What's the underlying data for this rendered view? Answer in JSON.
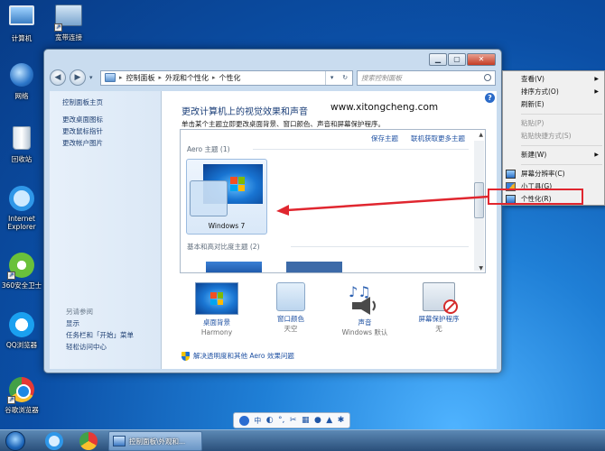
{
  "desktop": {
    "icons": [
      {
        "name": "computer",
        "label": "计算机"
      },
      {
        "name": "broadband",
        "label": "宽带连接"
      },
      {
        "name": "network",
        "label": "网络"
      },
      {
        "name": "recycle-bin",
        "label": "回收站"
      },
      {
        "name": "ie",
        "label": "Internet Explorer"
      },
      {
        "name": "360",
        "label": "360安全卫士"
      },
      {
        "name": "qq-browser",
        "label": "QQ浏览器"
      },
      {
        "name": "chrome",
        "label": "谷歌浏览器"
      }
    ]
  },
  "window": {
    "controls": {
      "minimize": "▁",
      "maximize": "▢",
      "close": "✕"
    },
    "breadcrumb": [
      "控制面板",
      "外观和个性化",
      "个性化"
    ],
    "search_placeholder": "搜索控制面板",
    "sidebar": {
      "home": "控制面板主页",
      "links": [
        "更改桌面图标",
        "更改鼠标指针",
        "更改帐户图片"
      ],
      "see_also_title": "另请参阅",
      "see_also": [
        "显示",
        "任务栏和「开始」菜单",
        "轻松访问中心"
      ]
    },
    "main": {
      "title": "更改计算机上的视觉效果和声音",
      "watermark": "www.xitongcheng.com",
      "description": "单击某个主题立即更改桌面背景、窗口颜色、声音和屏幕保护程序。",
      "save_theme": "保存主题",
      "get_more_themes": "联机获取更多主题",
      "aero_group": "Aero 主题 (1)",
      "theme_name": "Windows 7",
      "basic_group": "基本和高对比度主题 (2)",
      "items": [
        {
          "label": "桌面背景",
          "value": "Harmony"
        },
        {
          "label": "窗口颜色",
          "value": "天空"
        },
        {
          "label": "声音",
          "value": "Windows 默认"
        },
        {
          "label": "屏幕保护程序",
          "value": "无"
        }
      ],
      "aero_help": "解决透明度和其他 Aero 效果问题",
      "help": "?"
    }
  },
  "context_menu": {
    "items": [
      {
        "label": "查看(V)",
        "submenu": true,
        "disabled": false
      },
      {
        "label": "排序方式(O)",
        "submenu": true,
        "disabled": false
      },
      {
        "label": "刷新(E)",
        "submenu": false,
        "disabled": false
      },
      {
        "label": "粘贴(P)",
        "submenu": false,
        "disabled": true
      },
      {
        "label": "粘贴快捷方式(S)",
        "submenu": false,
        "disabled": true
      },
      {
        "label": "新建(W)",
        "submenu": true,
        "disabled": false
      },
      {
        "label": "屏幕分辨率(C)",
        "submenu": false,
        "disabled": false
      },
      {
        "label": "小工具(G)",
        "submenu": false,
        "disabled": false
      },
      {
        "label": "个性化(R)",
        "submenu": false,
        "disabled": false
      }
    ],
    "highlight_color": "#e0262f"
  },
  "ime_bar": {
    "lang": "中"
  },
  "taskbar": {
    "task_label": "控制面板\\外观和..."
  }
}
